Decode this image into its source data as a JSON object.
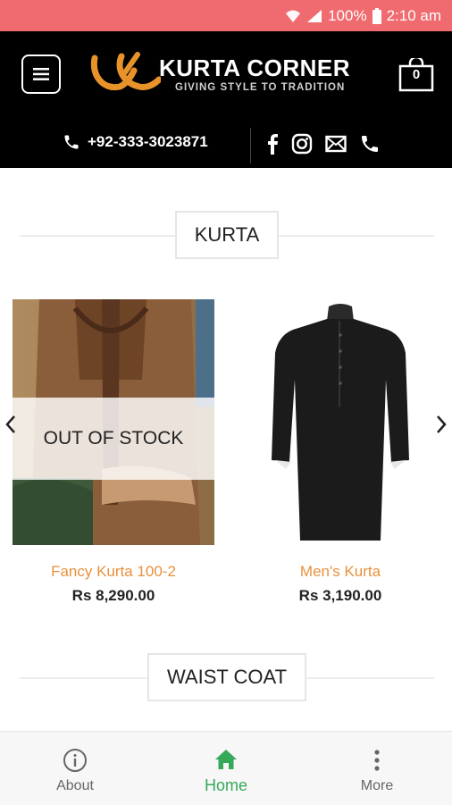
{
  "status_bar": {
    "battery": "100%",
    "time": "2:10 am"
  },
  "header": {
    "logo_title": "KURTA CORNER",
    "logo_tagline": "GIVING STYLE TO TRADITION",
    "cart_count": "0",
    "phone": "+92-333-3023871"
  },
  "sections": [
    {
      "title": "KURTA"
    },
    {
      "title": "WAIST COAT"
    }
  ],
  "products": [
    {
      "name": "Fancy Kurta 100-2",
      "price": "Rs 8,290.00",
      "overlay": "OUT OF STOCK"
    },
    {
      "name": "Men's Kurta",
      "price": "Rs 3,190.00"
    }
  ],
  "bottom_nav": [
    {
      "label": "About",
      "icon": "info-icon"
    },
    {
      "label": "Home",
      "icon": "home-icon",
      "active": true
    },
    {
      "label": "More",
      "icon": "more-vertical-icon"
    }
  ],
  "colors": {
    "status_bar": "#f06b6f",
    "header_bg": "#000000",
    "logo_accent": "#e8932a",
    "product_name": "#e8913d",
    "active_nav": "#36a85a"
  }
}
